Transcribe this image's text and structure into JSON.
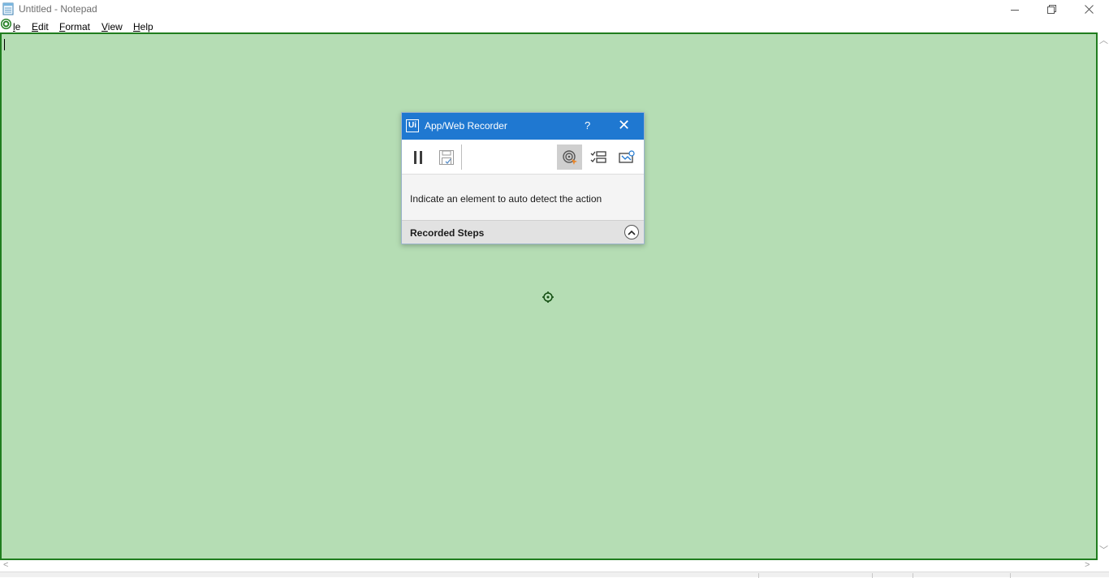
{
  "window": {
    "title": "Untitled - Notepad",
    "icons": {
      "app": "notepad-icon",
      "minimize": "minimize-icon",
      "restore": "restore-icon",
      "close": "close-icon"
    }
  },
  "menu": {
    "items": [
      {
        "label": "le",
        "name": "menu-file"
      },
      {
        "label": "Edit",
        "name": "menu-edit"
      },
      {
        "label": "Format",
        "name": "menu-format"
      },
      {
        "label": "View",
        "name": "menu-view"
      },
      {
        "label": "Help",
        "name": "menu-help"
      }
    ]
  },
  "editor": {
    "content": "",
    "highlight_color": "#b5ddb4",
    "highlight_border": "#1f7d1e"
  },
  "recorder": {
    "logo": "Ui",
    "title": "App/Web Recorder",
    "help": "?",
    "close": "✕",
    "accent": "#1f78d1",
    "toolbar": [
      {
        "name": "pause-icon",
        "active": false
      },
      {
        "name": "save-steps-icon",
        "active": false
      },
      {
        "name": "auto-detect-target-icon",
        "active": true
      },
      {
        "name": "checklist-icon",
        "active": false
      },
      {
        "name": "screen-capture-icon",
        "active": false
      }
    ],
    "instruction": "Indicate an element to auto detect the action",
    "recorded_steps_label": "Recorded Steps"
  }
}
